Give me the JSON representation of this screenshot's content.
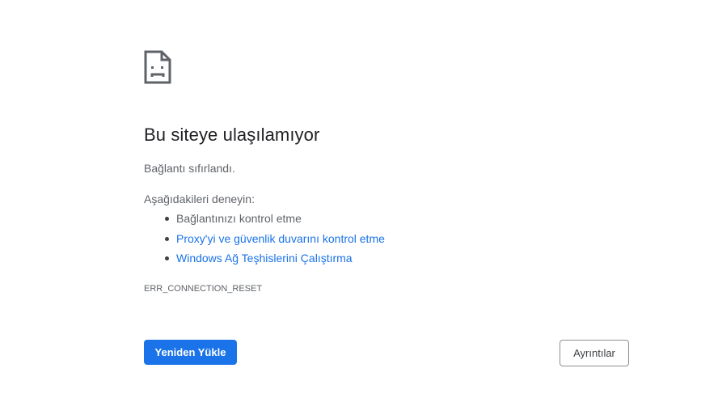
{
  "error_page": {
    "icon": "sad-page-icon",
    "title": "Bu siteye ulaşılamıyor",
    "subtitle": "Bağlantı sıfırlandı.",
    "suggestions_heading": "Aşağıdakileri deneyin:",
    "suggestions": [
      {
        "label": "Bağlantınızı kontrol etme",
        "is_link": false
      },
      {
        "label": "Proxy'yi ve güvenlik duvarını kontrol etme",
        "is_link": true
      },
      {
        "label": "Windows Ağ Teşhislerini Çalıştırma",
        "is_link": true
      }
    ],
    "error_code": "ERR_CONNECTION_RESET",
    "reload_label": "Yeniden Yükle",
    "details_label": "Ayrıntılar"
  },
  "colors": {
    "primary_blue": "#1a73e8",
    "text_dark": "#202124",
    "text_gray": "#5f6368",
    "background": "#ffffff"
  }
}
